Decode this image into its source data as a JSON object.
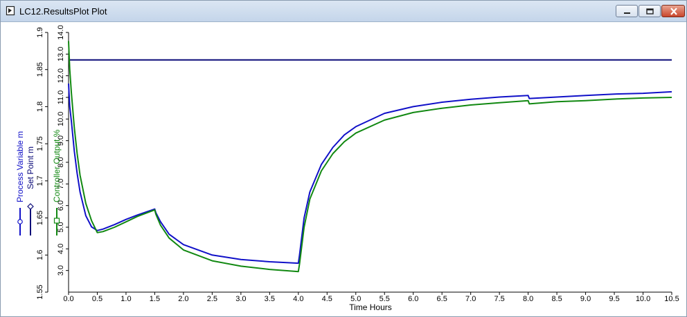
{
  "window": {
    "title": "LC12.ResultsPlot Plot"
  },
  "colors": {
    "process_variable": "#1010c8",
    "set_point": "#0a0a78",
    "controller_output": "#118811"
  },
  "chart_data": {
    "type": "line",
    "xlabel": "Time Hours",
    "xlim": [
      0,
      10.5
    ],
    "x_ticks": [
      "0.0",
      "0.5",
      "1.0",
      "1.5",
      "2.0",
      "2.5",
      "3.0",
      "3.5",
      "4.0",
      "4.5",
      "5.0",
      "5.5",
      "6.0",
      "6.5",
      "7.0",
      "7.5",
      "8.0",
      "8.5",
      "9.0",
      "9.5",
      "10.0",
      "10.5"
    ],
    "left_axis": {
      "labels": [
        "Process Variable m",
        "Set Point m"
      ],
      "ylim": [
        1.55,
        1.9
      ],
      "ticks": [
        "1.55",
        "1.6",
        "1.65",
        "1.7",
        "1.75",
        "1.8",
        "1.85",
        "1.9"
      ]
    },
    "right_axis": {
      "label": "Controller Output %",
      "ylim": [
        2.0,
        14.0
      ],
      "ticks": [
        "3.0",
        "4.0",
        "5.0",
        "6.0",
        "7.0",
        "8.0",
        "9.0",
        "10.0",
        "11.0",
        "12.0",
        "13.0",
        "14.0"
      ]
    },
    "series": [
      {
        "name": "Process Variable m",
        "axis": "left",
        "x": [
          0,
          0.02,
          0.05,
          0.1,
          0.15,
          0.2,
          0.3,
          0.4,
          0.5,
          0.6,
          0.8,
          1.0,
          1.2,
          1.5,
          1.52,
          1.6,
          1.75,
          2.0,
          2.5,
          3.0,
          3.5,
          4.0,
          4.02,
          4.1,
          4.2,
          4.4,
          4.6,
          4.8,
          5.0,
          5.5,
          6.0,
          6.5,
          7.0,
          7.5,
          8.0,
          8.02,
          8.5,
          9.0,
          9.5,
          10.0,
          10.5
        ],
        "y": [
          1.831,
          1.8,
          1.78,
          1.74,
          1.71,
          1.685,
          1.653,
          1.638,
          1.633,
          1.635,
          1.641,
          1.648,
          1.654,
          1.662,
          1.657,
          1.645,
          1.628,
          1.614,
          1.6,
          1.594,
          1.591,
          1.589,
          1.6,
          1.65,
          1.685,
          1.722,
          1.745,
          1.762,
          1.773,
          1.791,
          1.8,
          1.806,
          1.81,
          1.813,
          1.815,
          1.811,
          1.813,
          1.815,
          1.817,
          1.818,
          1.82
        ]
      },
      {
        "name": "Set Point m",
        "axis": "left",
        "x": [
          0,
          10.5
        ],
        "y": [
          1.863,
          1.863
        ]
      },
      {
        "name": "Controller Output %",
        "axis": "right",
        "x": [
          0,
          0.02,
          0.05,
          0.1,
          0.15,
          0.2,
          0.3,
          0.4,
          0.5,
          0.6,
          0.8,
          1.0,
          1.2,
          1.5,
          1.52,
          1.6,
          1.75,
          2.0,
          2.5,
          3.0,
          3.5,
          4.0,
          4.02,
          4.1,
          4.2,
          4.4,
          4.6,
          4.8,
          5.0,
          5.5,
          6.0,
          6.5,
          7.0,
          7.5,
          8.0,
          8.02,
          8.5,
          9.0,
          9.5,
          10.0,
          10.5
        ],
        "y": [
          13.6,
          12.3,
          11.2,
          9.6,
          8.4,
          7.4,
          6.1,
          5.3,
          4.75,
          4.8,
          5.0,
          5.25,
          5.5,
          5.8,
          5.6,
          5.1,
          4.5,
          3.95,
          3.45,
          3.2,
          3.05,
          2.95,
          3.3,
          5.0,
          6.3,
          7.6,
          8.4,
          8.95,
          9.35,
          9.95,
          10.3,
          10.5,
          10.65,
          10.75,
          10.85,
          10.7,
          10.8,
          10.85,
          10.92,
          10.97,
          11.0
        ]
      }
    ]
  }
}
